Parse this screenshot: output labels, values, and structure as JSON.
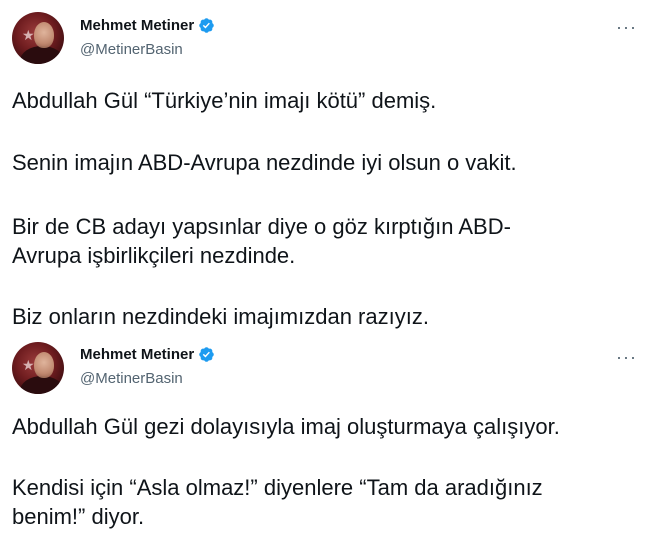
{
  "tweets": [
    {
      "author": {
        "name": "Mehmet Metiner",
        "handle": "@MetinerBasin"
      },
      "more_icon": "more-horizontal-icon",
      "paragraphs": [
        [
          "Abdullah Gül “Türkiye’nin imajı kötü” demiş."
        ],
        [
          "Senin imajın ABD-Avrupa nezdinde iyi olsun o vakit."
        ],
        [
          "Bir de CB adayı yapsınlar diye o göz kırptığın ABD-",
          "Avrupa işbirlikçileri nezdinde."
        ],
        [
          "Biz onların nezdindeki imajımızdan razıyız."
        ]
      ]
    },
    {
      "author": {
        "name": "Mehmet Metiner",
        "handle": "@MetinerBasin"
      },
      "more_icon": "more-horizontal-icon",
      "paragraphs": [
        [
          "Abdullah Gül gezi dolayısıyla imaj oluşturmaya çalışıyor."
        ],
        [
          "Kendisi için “Asla olmaz!” diyenlere “Tam da aradığınız",
          "benim!” diyor."
        ]
      ]
    }
  ],
  "colors": {
    "text": "#0f1419",
    "secondary": "#536471",
    "verified": "#1d9bf0",
    "avatar_bg": "#6e1c1f"
  }
}
